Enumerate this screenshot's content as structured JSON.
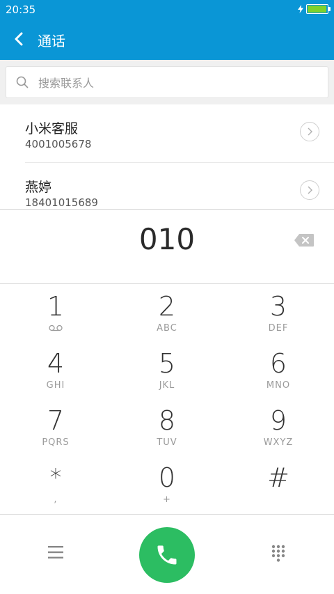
{
  "status_bar": {
    "time": "20:35",
    "battery_level": 0.95,
    "charging": true
  },
  "header": {
    "title": "通话",
    "back_icon": "chevron-left-icon"
  },
  "search": {
    "placeholder": "搜索联系人",
    "value": ""
  },
  "contacts": [
    {
      "name": "小米客服",
      "number": "4001005678"
    },
    {
      "name": "燕婷",
      "number": "18401015689"
    }
  ],
  "dialer": {
    "entered_number": "010"
  },
  "keypad": [
    {
      "digit": "1",
      "letters": "",
      "sub_icon": "voicemail-icon"
    },
    {
      "digit": "2",
      "letters": "ABC"
    },
    {
      "digit": "3",
      "letters": "DEF"
    },
    {
      "digit": "4",
      "letters": "GHI"
    },
    {
      "digit": "5",
      "letters": "JKL"
    },
    {
      "digit": "6",
      "letters": "MNO"
    },
    {
      "digit": "7",
      "letters": "PQRS"
    },
    {
      "digit": "8",
      "letters": "TUV"
    },
    {
      "digit": "9",
      "letters": "WXYZ"
    },
    {
      "digit": "*",
      "letters": ","
    },
    {
      "digit": "0",
      "letters": "+"
    },
    {
      "digit": "#",
      "letters": ""
    }
  ],
  "colors": {
    "header_bg": "#0a96d6",
    "call_button": "#2cbd62",
    "battery_fill": "#7ed22c"
  }
}
